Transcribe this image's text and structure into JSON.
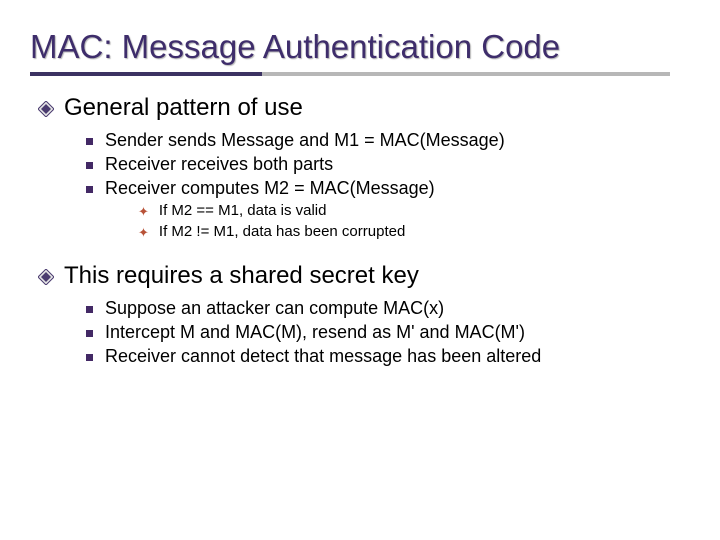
{
  "title": "MAC: Message Authentication Code",
  "sections": [
    {
      "heading": "General pattern of use",
      "items": [
        {
          "text": "Sender sends Message and M1 = MAC(Message)"
        },
        {
          "text": "Receiver receives both parts"
        },
        {
          "text": "Receiver computes M2 = MAC(Message)",
          "subitems": [
            "If M2 == M1, data is valid",
            "If M2 != M1, data has been corrupted"
          ]
        }
      ]
    },
    {
      "heading": "This requires a shared secret key",
      "items": [
        {
          "text": "Suppose an attacker can compute MAC(x)"
        },
        {
          "text": "Intercept M and MAC(M),  resend as M' and MAC(M')"
        },
        {
          "text": "Receiver cannot detect that message has been altered"
        }
      ]
    }
  ]
}
